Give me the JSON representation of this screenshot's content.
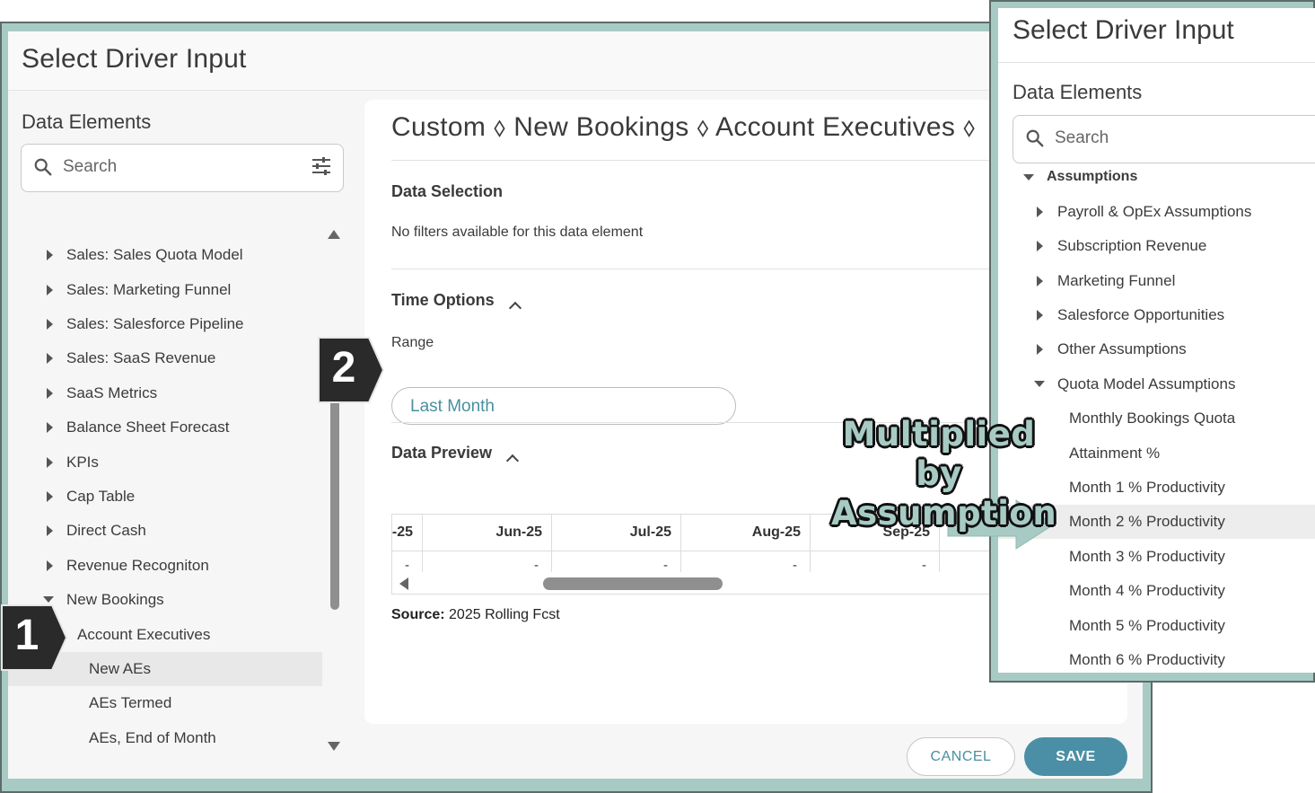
{
  "main_dialog": {
    "title": "Select Driver Input",
    "data_elements_title": "Data Elements",
    "search_placeholder": "Search",
    "tree": [
      {
        "label": "Sales: Sales Quota Model",
        "expanded": false
      },
      {
        "label": "Sales: Marketing Funnel",
        "expanded": false
      },
      {
        "label": "Sales: Salesforce Pipeline",
        "expanded": false
      },
      {
        "label": "Sales: SaaS Revenue",
        "expanded": false
      },
      {
        "label": "SaaS Metrics",
        "expanded": false
      },
      {
        "label": "Balance Sheet Forecast",
        "expanded": false
      },
      {
        "label": "KPIs",
        "expanded": false
      },
      {
        "label": "Cap Table",
        "expanded": false
      },
      {
        "label": "Direct Cash",
        "expanded": false
      },
      {
        "label": "Revenue Recogniton",
        "expanded": false
      },
      {
        "label": "New Bookings",
        "expanded": true
      },
      {
        "label": "Account Executives",
        "expanded": true
      },
      {
        "label": "New AEs",
        "selected": true
      },
      {
        "label": "AEs Termed"
      },
      {
        "label": "AEs, End of Month"
      }
    ],
    "breadcrumb": "Custom ⬨ New Bookings ⬨ Account Executives ⬨",
    "data_selection": {
      "title": "Data Selection",
      "message": "No filters available for this data element"
    },
    "time_options": {
      "title": "Time Options",
      "range_label": "Range",
      "range_value": "Last Month"
    },
    "data_preview": {
      "title": "Data Preview",
      "columns": [
        "-25",
        "Jun-25",
        "Jul-25",
        "Aug-25",
        "Sep-25"
      ],
      "values": [
        "-",
        "-",
        "-",
        "-",
        "-"
      ]
    },
    "source": {
      "label": "Source:",
      "value": "2025 Rolling Fcst"
    },
    "buttons": {
      "cancel": "CANCEL",
      "save": "SAVE"
    }
  },
  "callouts": {
    "one": "1",
    "two": "2",
    "annotation_line1": "Multiplied by",
    "annotation_line2": "Assumption"
  },
  "side_dialog": {
    "title": "Select Driver Input",
    "data_elements_title": "Data Elements",
    "search_placeholder": "Search",
    "tree": [
      {
        "label": "Assumptions",
        "expanded": true,
        "bold": true
      },
      {
        "label": "Payroll & OpEx Assumptions"
      },
      {
        "label": "Subscription Revenue"
      },
      {
        "label": "Marketing Funnel"
      },
      {
        "label": "Salesforce Opportunities"
      },
      {
        "label": "Other Assumptions"
      },
      {
        "label": "Quota Model Assumptions",
        "expanded": true
      },
      {
        "label": "Monthly Bookings Quota"
      },
      {
        "label": "Attainment %"
      },
      {
        "label": "Month 1 % Productivity"
      },
      {
        "label": "Month 2 % Productivity",
        "selected": true
      },
      {
        "label": "Month 3 % Productivity"
      },
      {
        "label": "Month 4 % Productivity"
      },
      {
        "label": "Month 5 % Productivity"
      },
      {
        "label": "Month 6 % Productivity"
      }
    ]
  },
  "colors": {
    "frame": "#a7cbc4",
    "accent": "#4b8fa6",
    "badge": "#222222"
  }
}
